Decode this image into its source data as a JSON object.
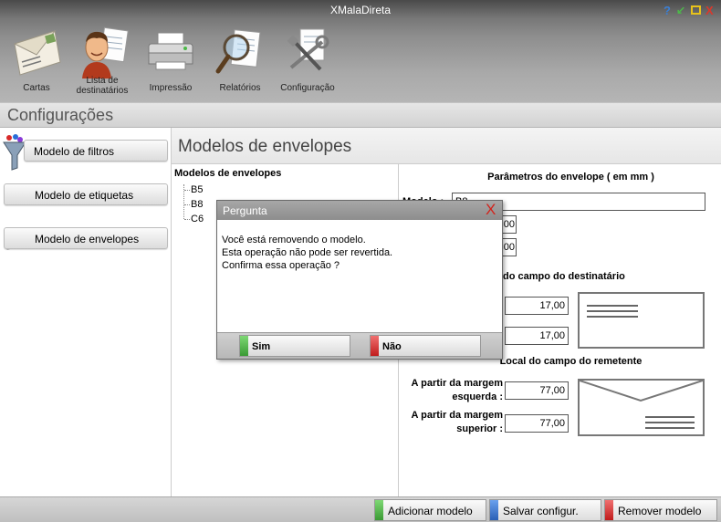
{
  "app": {
    "title": "XMalaDireta"
  },
  "window_controls": {
    "help": "?",
    "minimize": "↙",
    "close": "X"
  },
  "toolbar": {
    "cartas": "Cartas",
    "lista_line1": "Lista de",
    "lista_line2": "destinatários",
    "impressao": "Impressão",
    "relatorios": "Relatórios",
    "configuracao": "Configuração"
  },
  "section": {
    "title": "Configurações"
  },
  "nav": {
    "filtros": "Modelo de filtros",
    "etiquetas": "Modelo de etiquetas",
    "envelopes": "Modelo de envelopes"
  },
  "main": {
    "title": "Modelos de envelopes",
    "tree_title": "Modelos de envelopes",
    "tree_items": [
      "B5",
      "B8",
      "C6"
    ]
  },
  "params": {
    "title": "Parâmetros do envelope  ( em mm )",
    "modelo_label": "Modelo :",
    "modelo_value": "B8",
    "width_value": "00",
    "height_value": "00",
    "dest_section": "do campo do destinatário",
    "dest_left_value": "17,00",
    "dest_top_value": "17,00",
    "rem_section": "Local do campo do remetente",
    "rem_left_label_1": "A partir da margem",
    "rem_left_label_2": "esquerda :",
    "rem_left_value": "77,00",
    "rem_top_label_1": "A partir da margem",
    "rem_top_label_2": "superior :",
    "rem_top_value": "77,00"
  },
  "bottom": {
    "add": "Adicionar modelo",
    "save": "Salvar configur.",
    "remove": "Remover modelo"
  },
  "dialog": {
    "title": "Pergunta",
    "close": "X",
    "line1": "Você está removendo o modelo.",
    "line2": "Esta operação não pode ser revertida.",
    "line3": "Confirma essa operação ?",
    "yes": "Sim",
    "no": "Não"
  },
  "colors": {
    "green": "#4cb848",
    "blue": "#2f6fc7",
    "red": "#d8282a"
  }
}
